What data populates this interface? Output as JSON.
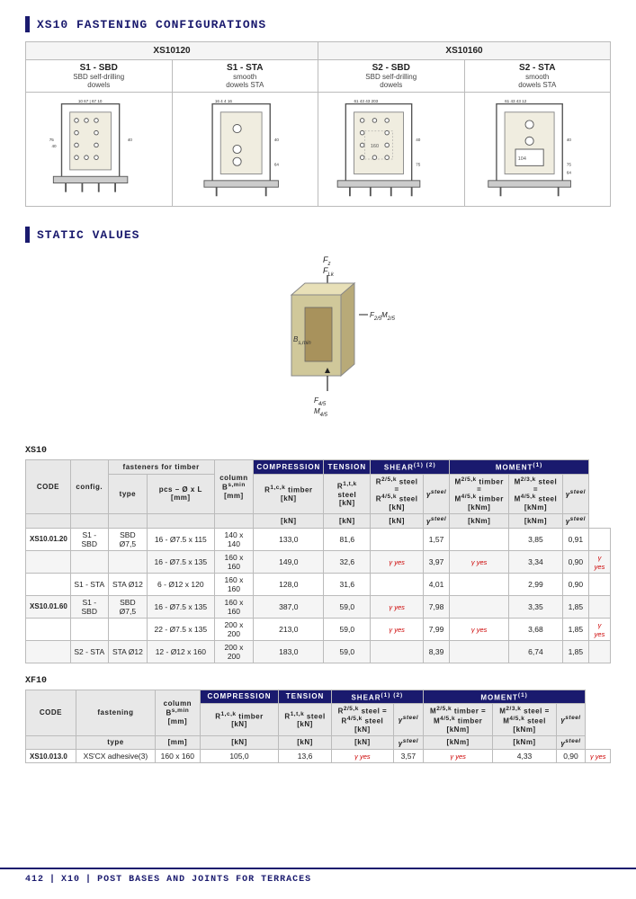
{
  "page": {
    "title": "412 | X10 | POST BASES AND JOINTS FOR TERRACES"
  },
  "section1": {
    "title": "XS10 FASTENING CONFIGURATIONS",
    "groups": [
      {
        "label": "XS10120",
        "cols": [
          {
            "code": "S1 - SBD",
            "desc": "SBD self-drilling dowels"
          },
          {
            "code": "S1 - STA",
            "desc": "smooth dowels STA"
          }
        ]
      },
      {
        "label": "XS10160",
        "cols": [
          {
            "code": "S2 - SBD",
            "desc": "SBD self-drilling dowels"
          },
          {
            "code": "S2 - STA",
            "desc": "smooth dowels STA"
          }
        ]
      }
    ]
  },
  "section2": {
    "title": "STATIC VALUES"
  },
  "tables": {
    "xs10_label": "XS10",
    "xs10_col_groups": [
      {
        "label": "COMPRESSION",
        "colspan": 1
      },
      {
        "label": "TENSION",
        "colspan": 1
      },
      {
        "label": "SHEAR",
        "sup": "(1) (2)",
        "colspan": 2
      },
      {
        "label": "MOMENT",
        "sup": "(1)",
        "colspan": 2
      }
    ],
    "xs10_sub_headers": [
      {
        "label": ""
      },
      {
        "label": "config."
      },
      {
        "label": "fasteners for timber"
      },
      {
        "label": "column\nB s,min\n[mm]"
      },
      {
        "label": "R 1,c,k timber\n[kN]"
      },
      {
        "label": "R 1,t,k steel\n[kN]"
      },
      {
        "label": ""
      },
      {
        "label": "R 2/5,k steel =\nR 4/5,k steel\n[kN]"
      },
      {
        "label": ""
      },
      {
        "label": "M 2/5,k timber =\nM 4/5,k timber\n[kNm]"
      },
      {
        "label": "M 2/3,k steel =\nM 4/5,k steel\n[kNm]"
      },
      {
        "label": ""
      }
    ],
    "xs10_rows": [
      {
        "code": "XS10.01.20",
        "config": "S1 - SBD",
        "type": "SBD Ø7,5",
        "pcs": "16 - Ø7.5 x 115",
        "column": "140 x 140",
        "r1ck": "133,0",
        "r1tk": "81,6",
        "gamma1": "",
        "r25k": "1,57",
        "gamma2": "",
        "m25k": "3,85",
        "m23k": "0,91",
        "gamma3": "",
        "alt": false
      },
      {
        "code": "",
        "config": "",
        "type": "",
        "pcs": "16 - Ø7.5 x 135",
        "column": "160 x 160",
        "r1ck": "149,0",
        "r1tk": "32,6",
        "gamma1": "γ yes",
        "r25k": "3,97",
        "gamma2": "γ yes",
        "m25k": "3,34",
        "m23k": "0,90",
        "gamma3": "γ yes",
        "alt": true
      },
      {
        "code": "",
        "config": "S1 - STA",
        "type": "STA Ø12",
        "pcs": "6 - Ø12 x 120",
        "column": "160 x 160",
        "r1ck": "128,0",
        "r1tk": "31,6",
        "gamma1": "",
        "r25k": "4,01",
        "gamma2": "",
        "m25k": "2,99",
        "m23k": "0,90",
        "gamma3": "",
        "alt": false
      },
      {
        "code": "XS10.01.60",
        "config": "S1 - SBD",
        "type": "SBD Ø7,5",
        "pcs": "16 - Ø7.5 x 135",
        "column": "160 x 160",
        "r1ck": "387,0",
        "r1tk": "59,0",
        "gamma1": "γ yes",
        "r25k": "7,98",
        "gamma2": "",
        "m25k": "3,35",
        "m23k": "1,85",
        "gamma3": "",
        "alt": true
      },
      {
        "code": "",
        "config": "",
        "type": "",
        "pcs": "22 - Ø7.5 x 135",
        "column": "200 x 200",
        "r1ck": "213,0",
        "r1tk": "59,0",
        "gamma1": "γ yes",
        "r25k": "7,99",
        "gamma2": "γ yes",
        "m25k": "3,68",
        "m23k": "1,85",
        "gamma3": "γ yes",
        "alt": false
      },
      {
        "code": "",
        "config": "S2 - STA",
        "type": "STA Ø12",
        "pcs": "12 - Ø12 x 160",
        "column": "200 x 200",
        "r1ck": "183,0",
        "r1tk": "59,0",
        "gamma1": "",
        "r25k": "8,39",
        "gamma2": "",
        "m25k": "6,74",
        "m23k": "1,85",
        "gamma3": "",
        "alt": true
      }
    ],
    "xf10_label": "XF10",
    "xf10_rows": [
      {
        "code": "XS10.013.0",
        "fastening_type": "XS'CX adhesive(3)",
        "column": "160 x 160",
        "r1ck": "105,0",
        "r1tk": "13,6",
        "gamma1": "γ yes",
        "r25k": "3,57",
        "gamma2": "γ yes",
        "m25k": "4,33",
        "m23k": "0,90",
        "gamma3": "γ yes",
        "alt": false
      }
    ]
  },
  "footer": {
    "page": "412",
    "product": "X10",
    "description": "POST BASES AND JOINTS FOR TERRACES"
  }
}
